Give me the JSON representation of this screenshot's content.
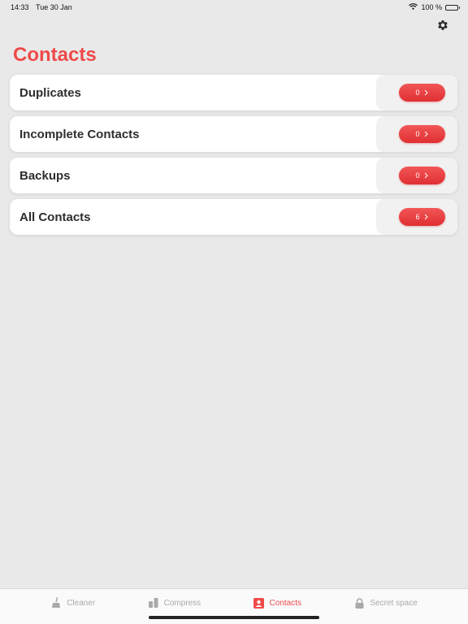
{
  "status_bar": {
    "time": "14:33",
    "date": "Tue 30 Jan",
    "battery": "100 %"
  },
  "header": {
    "title": "Contacts",
    "settings_icon": "gear-icon"
  },
  "rows": [
    {
      "label": "Duplicates",
      "count": "0"
    },
    {
      "label": "Incomplete Contacts",
      "count": "0"
    },
    {
      "label": "Backups",
      "count": "0"
    },
    {
      "label": "All Contacts",
      "count": "6"
    }
  ],
  "tabs": [
    {
      "label": "Cleaner",
      "icon": "broom-icon",
      "active": false
    },
    {
      "label": "Compress",
      "icon": "compress-icon",
      "active": false
    },
    {
      "label": "Contacts",
      "icon": "contact-card-icon",
      "active": true
    },
    {
      "label": "Secret space",
      "icon": "lock-icon",
      "active": false
    }
  ],
  "colors": {
    "accent": "#ef4a4a",
    "background": "#e9e9e9",
    "inactive_tab": "#a9a9a9"
  }
}
